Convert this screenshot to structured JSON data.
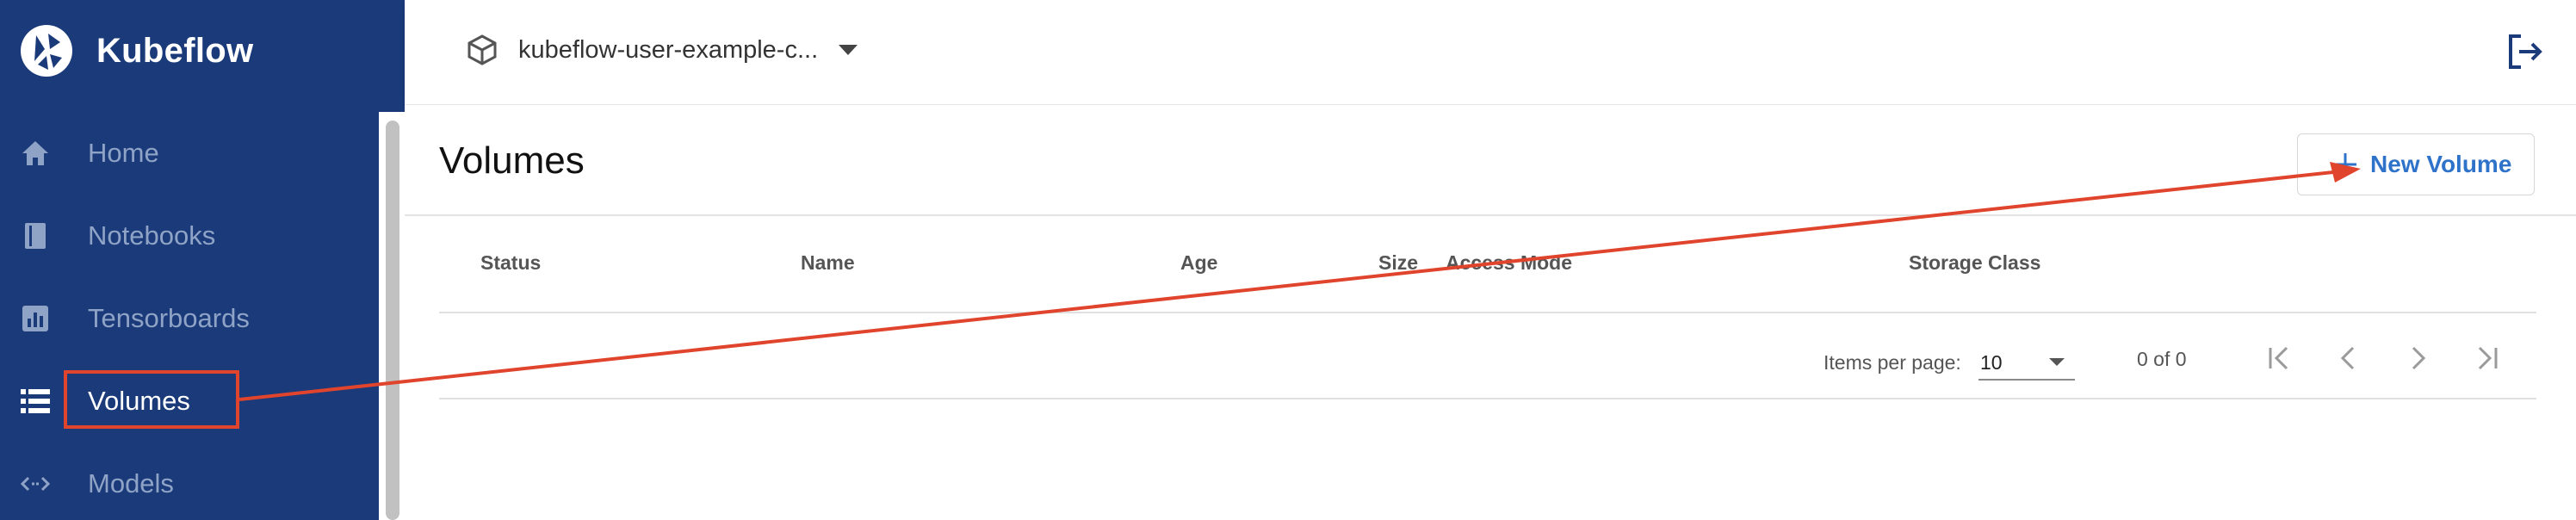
{
  "app": {
    "name": "Kubeflow"
  },
  "sidebar": {
    "items": [
      {
        "label": "Home",
        "icon": "home-icon"
      },
      {
        "label": "Notebooks",
        "icon": "notebook-icon"
      },
      {
        "label": "Tensorboards",
        "icon": "chart-icon"
      },
      {
        "label": "Volumes",
        "icon": "list-icon",
        "active": true
      },
      {
        "label": "Models",
        "icon": "code-arrows-icon"
      }
    ]
  },
  "header": {
    "namespace": "kubeflow-user-example-c...",
    "namespace_icon": "cube-icon",
    "logout_icon": "logout-icon"
  },
  "main": {
    "title": "Volumes",
    "new_button": {
      "label": "New Volume",
      "icon": "plus-icon"
    },
    "table": {
      "columns": [
        "Status",
        "Name",
        "Age",
        "Size",
        "Access Mode",
        "Storage Class"
      ],
      "rows": []
    },
    "paginator": {
      "items_per_page_label": "Items per page:",
      "items_per_page": "10",
      "range": "0 of 0"
    }
  },
  "colors": {
    "sidebar_bg": "#1a3a7a",
    "accent": "#2f72c9",
    "annotation": "#e0442c"
  }
}
